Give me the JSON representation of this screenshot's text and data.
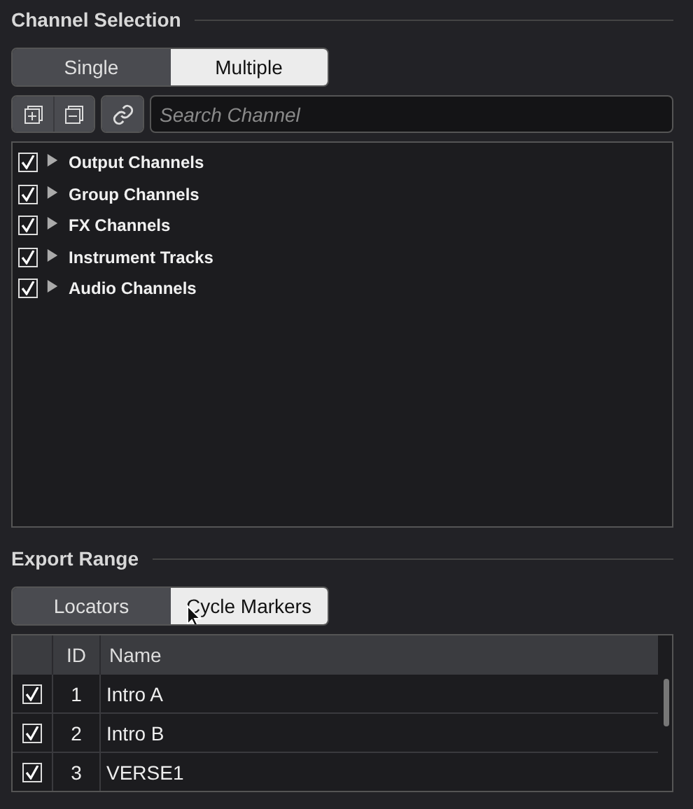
{
  "channel_selection": {
    "title": "Channel Selection",
    "modes": [
      {
        "label": "Single",
        "selected": false
      },
      {
        "label": "Multiple",
        "selected": true
      }
    ],
    "search": {
      "placeholder": "Search Channel"
    },
    "tree": [
      {
        "label": "Output Channels",
        "checked": true,
        "expanded": false
      },
      {
        "label": "Group Channels",
        "checked": true,
        "expanded": false
      },
      {
        "label": "FX Channels",
        "checked": true,
        "expanded": false
      },
      {
        "label": "Instrument Tracks",
        "checked": true,
        "expanded": false
      },
      {
        "label": "Audio Channels",
        "checked": true,
        "expanded": false
      }
    ]
  },
  "export_range": {
    "title": "Export Range",
    "modes": [
      {
        "label": "Locators",
        "selected": false
      },
      {
        "label": "Cycle Markers",
        "selected": true
      }
    ],
    "table": {
      "columns": [
        "ID",
        "Name"
      ],
      "rows": [
        {
          "checked": true,
          "id": "1",
          "name": "Intro A"
        },
        {
          "checked": true,
          "id": "2",
          "name": "Intro B"
        },
        {
          "checked": true,
          "id": "3",
          "name": "VERSE1"
        }
      ]
    }
  }
}
